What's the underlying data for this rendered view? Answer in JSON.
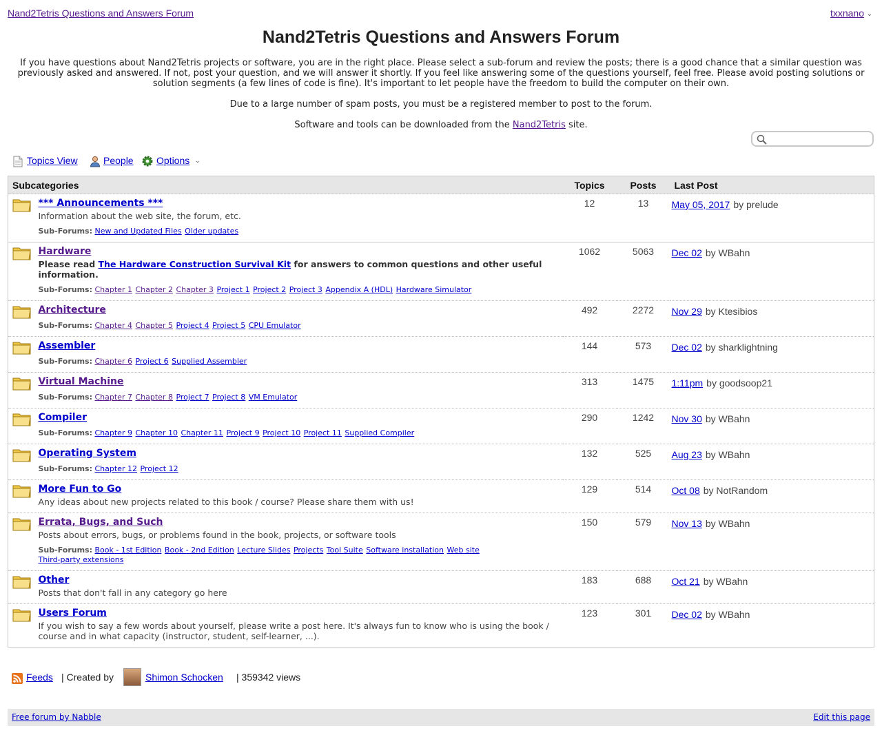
{
  "topbar": {
    "home_link": "Nand2Tetris Questions and Answers Forum",
    "user_name": "txxnano",
    "user_menu_icon": "chevron-down-icon"
  },
  "page_title": "Nand2Tetris Questions and Answers Forum",
  "intro": {
    "p1": "If you have questions about Nand2Tetris projects or software, you are in the right place. Please select a sub-forum and review the posts; there is a good chance that a similar question was previously asked and answered. If not,  post your question, and we will answer it shortly. If you feel like answering some of the questions yourself, feel free. Please avoid posting solutions or solution segments (a few lines of code is fine). It's important to let people have the freedom to build the computer on their own.",
    "p2": "Due to a large number of spam posts, you must be a registered member to post to the forum.",
    "p3_before": "Software and tools can be downloaded from the ",
    "p3_link": "Nand2Tetris",
    "p3_after": " site."
  },
  "search": {
    "placeholder": "",
    "value": "",
    "icon": "search-icon"
  },
  "view_links": {
    "topics_view": "Topics View",
    "people": "People",
    "options": "Options"
  },
  "table": {
    "headers": {
      "subcategories": "Subcategories",
      "topics": "Topics",
      "posts": "Posts",
      "last_post": "Last Post"
    },
    "sub_forums_label": "Sub-Forums:",
    "rows": [
      {
        "name": "*** Announcements ***",
        "desc": "Information about the web site, the forum, etc.",
        "topics": "12",
        "posts": "13",
        "last_date": "May 05, 2017",
        "last_by": "by prelude",
        "sub_forums": [
          "New and Updated Files",
          "Older updates"
        ]
      },
      {
        "name": "Hardware",
        "desc_before": "Please read ",
        "desc_link": "The Hardware Construction Survival Kit",
        "desc_after": " for answers to common questions and other useful information.",
        "topics": "1062",
        "posts": "5063",
        "last_date": "Dec 02",
        "last_by": "by WBahn",
        "sub_forums": [
          "Chapter 1",
          "Chapter 2",
          "Chapter 3",
          "Project 1",
          "Project 2",
          "Project 3",
          "Appendix A (HDL)",
          "Hardware Simulator"
        ]
      },
      {
        "name": "Architecture",
        "topics": "492",
        "posts": "2272",
        "last_date": "Nov 29",
        "last_by": "by Ktesibios",
        "sub_forums": [
          "Chapter 4",
          "Chapter 5",
          "Project 4",
          "Project 5",
          "CPU Emulator"
        ]
      },
      {
        "name": "Assembler",
        "topics": "144",
        "posts": "573",
        "last_date": "Dec 02",
        "last_by": "by sharklightning",
        "sub_forums": [
          "Chapter 6",
          "Project 6",
          "Supplied Assembler"
        ]
      },
      {
        "name": "Virtual Machine",
        "topics": "313",
        "posts": "1475",
        "last_date": "1:11pm",
        "last_by": "by goodsoop21",
        "sub_forums": [
          "Chapter 7",
          "Chapter 8",
          "Project 7",
          "Project 8",
          "VM Emulator"
        ]
      },
      {
        "name": "Compiler",
        "topics": "290",
        "posts": "1242",
        "last_date": "Nov 30",
        "last_by": "by WBahn",
        "sub_forums": [
          "Chapter 9",
          "Chapter 10",
          "Chapter 11",
          "Project 9",
          "Project 10",
          "Project 11",
          "Supplied Compiler"
        ]
      },
      {
        "name": "Operating System",
        "topics": "132",
        "posts": "525",
        "last_date": "Aug 23",
        "last_by": "by WBahn",
        "sub_forums": [
          "Chapter 12",
          "Project 12"
        ]
      },
      {
        "name": "More Fun to Go",
        "desc": "Any ideas about new projects related to this book / course? Please share them with us!",
        "topics": "129",
        "posts": "514",
        "last_date": "Oct 08",
        "last_by": "by NotRandom"
      },
      {
        "name": "Errata, Bugs, and Such",
        "desc": "Posts about errors, bugs, or problems found in the book, projects, or software tools",
        "topics": "150",
        "posts": "579",
        "last_date": "Nov 13",
        "last_by": "by WBahn",
        "sub_forums": [
          "Book - 1st Edition",
          "Book - 2nd Edition",
          "Lecture Slides",
          "Projects",
          "Tool Suite",
          "Software installation",
          "Web site",
          "Third-party extensions"
        ]
      },
      {
        "name": "Other",
        "desc": "Posts that don't fall in any category go here",
        "topics": "183",
        "posts": "688",
        "last_date": "Oct 21",
        "last_by": "by WBahn"
      },
      {
        "name": "Users Forum",
        "desc": "If you wish to say a few words about yourself, please write a post here. It's always fun to know who is using the book / course and in what capacity (instructor, student, self-learner, ...).",
        "topics": "123",
        "posts": "301",
        "last_date": "Dec 02",
        "last_by": "by WBahn"
      }
    ]
  },
  "footer": {
    "feeds": "Feeds",
    "created_by": "| Created by",
    "creator": "Shimon Schocken",
    "views": "| 359342 views"
  },
  "bottom_bar": {
    "left_link": "Free forum by Nabble",
    "right_link": "Edit this page"
  },
  "colors": {
    "link": "#0000cc",
    "visited": "#551a8b",
    "header_bg": "#e6e6e6",
    "folder": "#f5d66b"
  }
}
